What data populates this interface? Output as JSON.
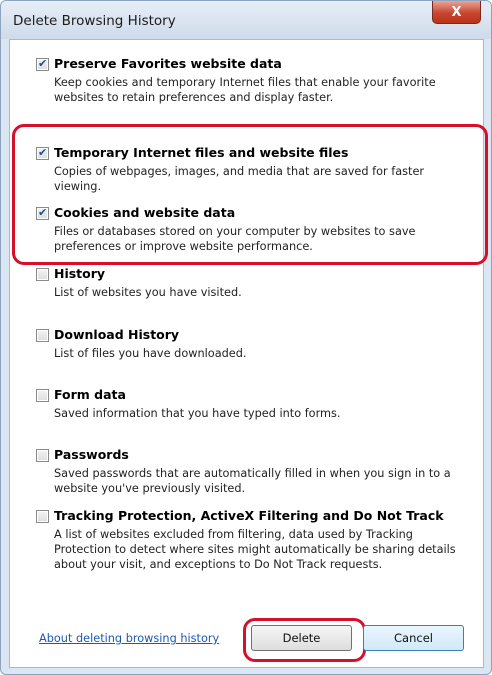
{
  "window": {
    "title": "Delete Browsing History",
    "close_glyph": "X"
  },
  "options": [
    {
      "title": "Preserve Favorites website data",
      "checked": true,
      "desc": "Keep cookies and temporary Internet files that enable your favorite websites to retain preferences and display faster."
    },
    {
      "title": "Temporary Internet files and website files",
      "checked": true,
      "desc": "Copies of webpages, images, and media that are saved for faster viewing."
    },
    {
      "title": "Cookies and website data",
      "checked": true,
      "desc": "Files or databases stored on your computer by websites to save preferences or improve website performance."
    },
    {
      "title": "History",
      "checked": false,
      "desc": "List of websites you have visited."
    },
    {
      "title": "Download History",
      "checked": false,
      "desc": "List of files you have downloaded."
    },
    {
      "title": "Form data",
      "checked": false,
      "desc": "Saved information that you have typed into forms."
    },
    {
      "title": "Passwords",
      "checked": false,
      "desc": "Saved passwords that are automatically filled in when you sign in to a website you've previously visited."
    },
    {
      "title": "Tracking Protection, ActiveX Filtering and Do Not Track",
      "checked": false,
      "desc": "A list of websites excluded from filtering, data used by Tracking Protection to detect where sites might automatically be sharing details about your visit, and exceptions to Do Not Track requests."
    }
  ],
  "footer": {
    "help_link": "About deleting browsing history",
    "delete_label": "Delete",
    "cancel_label": "Cancel"
  },
  "colors": {
    "highlight": "#d6102a",
    "link": "#1a59b6"
  }
}
